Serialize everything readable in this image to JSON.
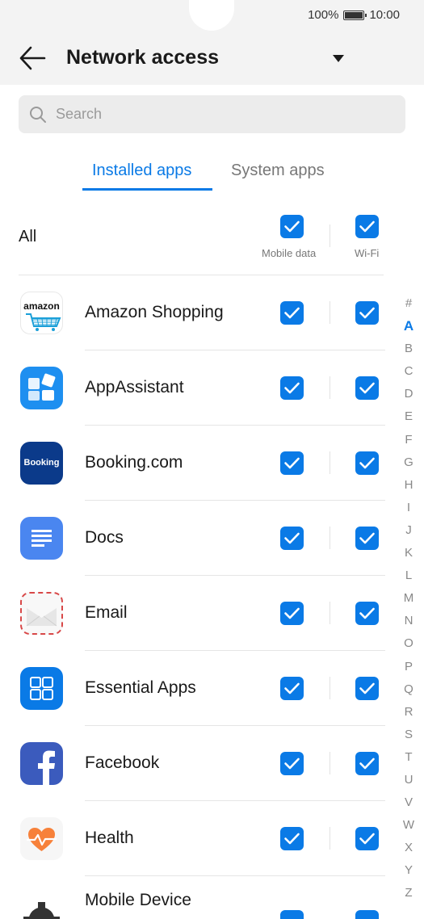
{
  "status": {
    "battery": "100%",
    "time": "10:00"
  },
  "header": {
    "title": "Network access"
  },
  "search": {
    "placeholder": "Search"
  },
  "tabs": [
    {
      "label": "Installed apps"
    },
    {
      "label": "System apps"
    }
  ],
  "all_row": {
    "label": "All",
    "mobile_data_label": "Mobile data",
    "wifi_label": "Wi-Fi",
    "mobile_data_checked": true,
    "wifi_checked": true
  },
  "apps": [
    {
      "name": "Amazon Shopping",
      "icon": "amazon-icon",
      "mobile_data": true,
      "wifi": true
    },
    {
      "name": "AppAssistant",
      "icon": "app-assistant-icon",
      "mobile_data": true,
      "wifi": true
    },
    {
      "name": "Booking.com",
      "icon": "booking-icon",
      "mobile_data": true,
      "wifi": true
    },
    {
      "name": "Docs",
      "icon": "docs-icon",
      "mobile_data": true,
      "wifi": true
    },
    {
      "name": "Email",
      "icon": "email-icon",
      "mobile_data": true,
      "wifi": true
    },
    {
      "name": "Essential Apps",
      "icon": "essential-apps-icon",
      "mobile_data": true,
      "wifi": true
    },
    {
      "name": "Facebook",
      "icon": "facebook-icon",
      "mobile_data": true,
      "wifi": true
    },
    {
      "name": "Health",
      "icon": "health-icon",
      "mobile_data": true,
      "wifi": true
    },
    {
      "name": "Mobile Device",
      "icon": "mobile-device-icon",
      "mobile_data": true,
      "wifi": true
    }
  ],
  "icon_text": {
    "amazon": "amazon",
    "booking": "Booking"
  },
  "alphabet_index": [
    "#",
    "A",
    "B",
    "C",
    "D",
    "E",
    "F",
    "G",
    "H",
    "I",
    "J",
    "K",
    "L",
    "M",
    "N",
    "O",
    "P",
    "Q",
    "R",
    "S",
    "T",
    "U",
    "V",
    "W",
    "X",
    "Y",
    "Z"
  ],
  "alphabet_active": "A",
  "colors": {
    "accent": "#0a7ae6",
    "booking": "#0b3a8a",
    "facebook": "#1877f2",
    "health": "#f25f3a"
  }
}
